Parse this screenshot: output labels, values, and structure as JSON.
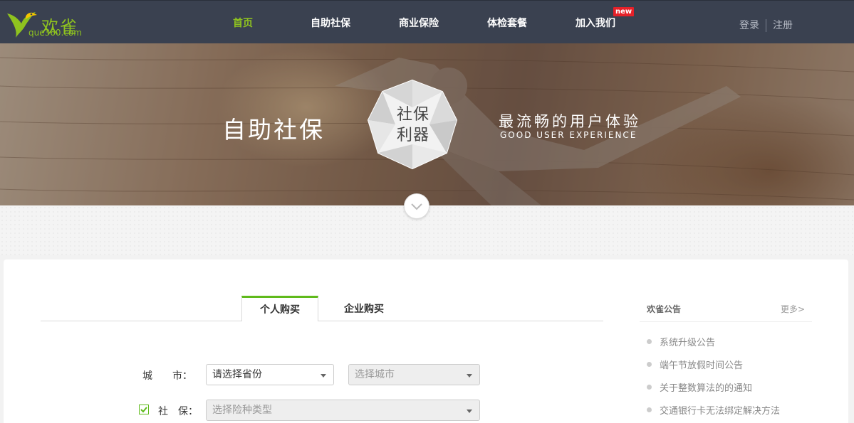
{
  "header": {
    "logo_text": "欢雀",
    "logo_sub": "que360.com",
    "nav": [
      {
        "label": "首页"
      },
      {
        "label": "自助社保"
      },
      {
        "label": "商业保险"
      },
      {
        "label": "体检套餐"
      },
      {
        "label": "加入我们"
      }
    ],
    "new_badge": "new",
    "login": "登录",
    "register": "注册"
  },
  "banner": {
    "title": "自助社保",
    "gem_line1": "社保",
    "gem_line2": "利器",
    "slogan": "最流畅的用户体验",
    "slogan_en": "GOOD USER EXPERIENCE"
  },
  "tabs": {
    "personal": "个人购买",
    "enterprise": "企业购买"
  },
  "form": {
    "city_label": "城　　市：",
    "province_select": "请选择省份",
    "city_select": "选择城市",
    "social_label": "社　保：",
    "social_select": "选择险种类型"
  },
  "notices": {
    "title": "欢雀公告",
    "more": "更多>",
    "items": [
      "系统升级公告",
      "端午节放假时间公告",
      "关于整数算法的的通知",
      "交通银行卡无法绑定解决方法"
    ]
  },
  "colors": {
    "header_bg": "#3a4150",
    "accent_green": "#8fc31f",
    "tab_green": "#5fba1b",
    "badge_red": "#e62129"
  }
}
